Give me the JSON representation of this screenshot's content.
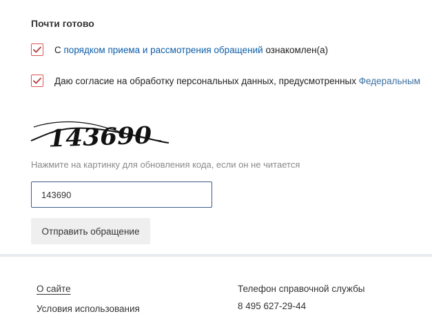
{
  "form": {
    "section_title": "Почти готово",
    "consent_rules": {
      "checked": true,
      "prefix": "С ",
      "link": "порядком приема и рассмотрения обращений",
      "suffix": " ознакомлен(а)"
    },
    "consent_personal_data": {
      "checked": true,
      "text": "Даю согласие на обработку персональных данных, предусмотренных ",
      "link": "Федеральным"
    },
    "captcha": {
      "code": "143690",
      "hint": "Нажмите на картинку для обновления кода, если он не читается"
    },
    "code_input": {
      "value": "143690"
    },
    "submit_label": "Отправить обращение"
  },
  "footer": {
    "links": [
      "О сайте",
      "Условия использования"
    ],
    "support_label": "Телефон справочной службы",
    "support_phone": "8 495 627-29-44"
  },
  "colors": {
    "checkbox_border": "#d9534f",
    "checkmark": "#b03a3a",
    "link": "#0e5ea8",
    "input_border": "#3d5a86",
    "button_bg": "#efefef",
    "divider": "#e7ebf0"
  }
}
